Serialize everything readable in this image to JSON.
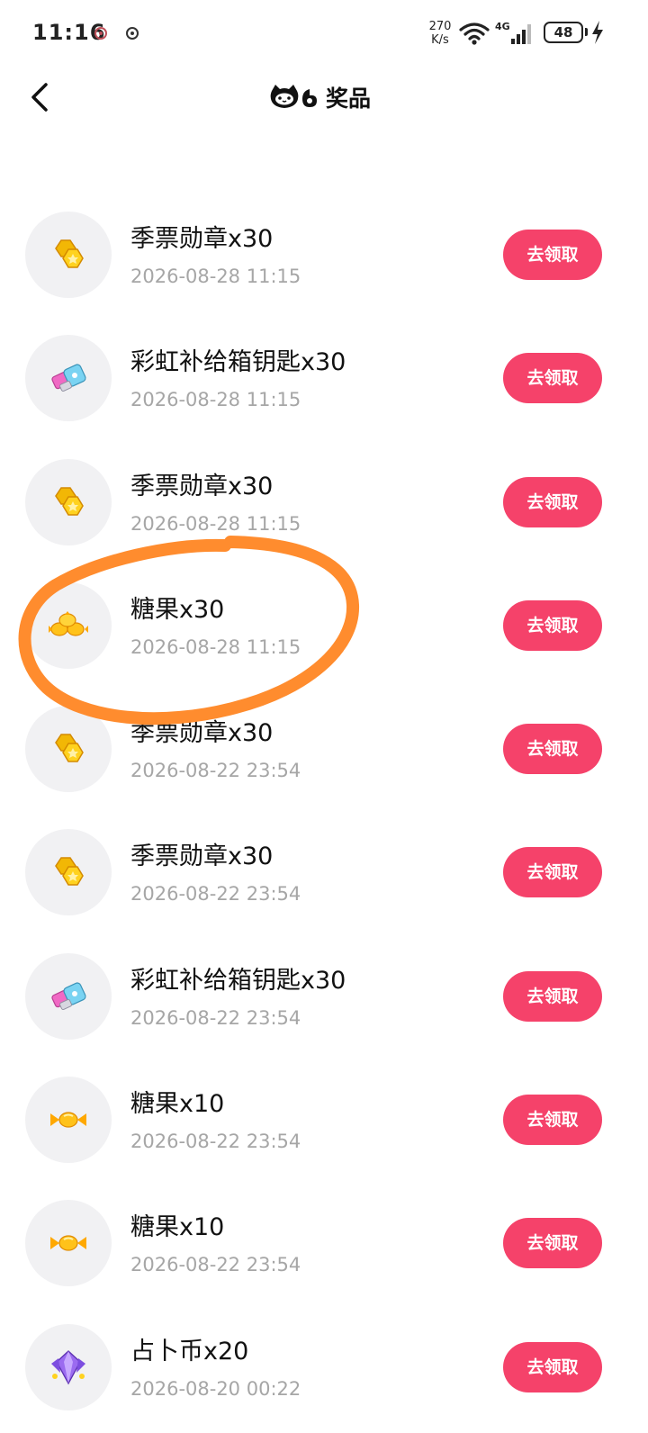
{
  "status_bar": {
    "time": "11:16",
    "net_speed_value": "270",
    "net_speed_unit": "K/s",
    "network_type": "4G",
    "battery_level": "48"
  },
  "header": {
    "title": "奖品",
    "logo_icon": "cat-logo-icon",
    "back_icon": "chevron-left-icon"
  },
  "claim_label": "去领取",
  "prizes": [
    {
      "name": "季票勋章x30",
      "time": "2026-08-28 11:15",
      "icon": "medal-coin-icon"
    },
    {
      "name": "彩虹补给箱钥匙x30",
      "time": "2026-08-28 11:15",
      "icon": "rainbow-key-icon"
    },
    {
      "name": "季票勋章x30",
      "time": "2026-08-28 11:15",
      "icon": "medal-coin-icon"
    },
    {
      "name": "糖果x30",
      "time": "2026-08-28 11:15",
      "icon": "candy-pile-icon"
    },
    {
      "name": "季票勋章x30",
      "time": "2026-08-22 23:54",
      "icon": "medal-coin-icon"
    },
    {
      "name": "季票勋章x30",
      "time": "2026-08-22 23:54",
      "icon": "medal-coin-icon"
    },
    {
      "name": "彩虹补给箱钥匙x30",
      "time": "2026-08-22 23:54",
      "icon": "rainbow-key-icon"
    },
    {
      "name": "糖果x10",
      "time": "2026-08-22 23:54",
      "icon": "candy-icon"
    },
    {
      "name": "糖果x10",
      "time": "2026-08-22 23:54",
      "icon": "candy-icon"
    },
    {
      "name": "占卜币x20",
      "time": "2026-08-20 00:22",
      "icon": "crystal-coin-icon"
    }
  ],
  "colors": {
    "accent": "#f5426a",
    "annotation": "#ff8c2e",
    "muted_text": "#a6a6a6",
    "thumb_bg": "#f1f1f3"
  }
}
